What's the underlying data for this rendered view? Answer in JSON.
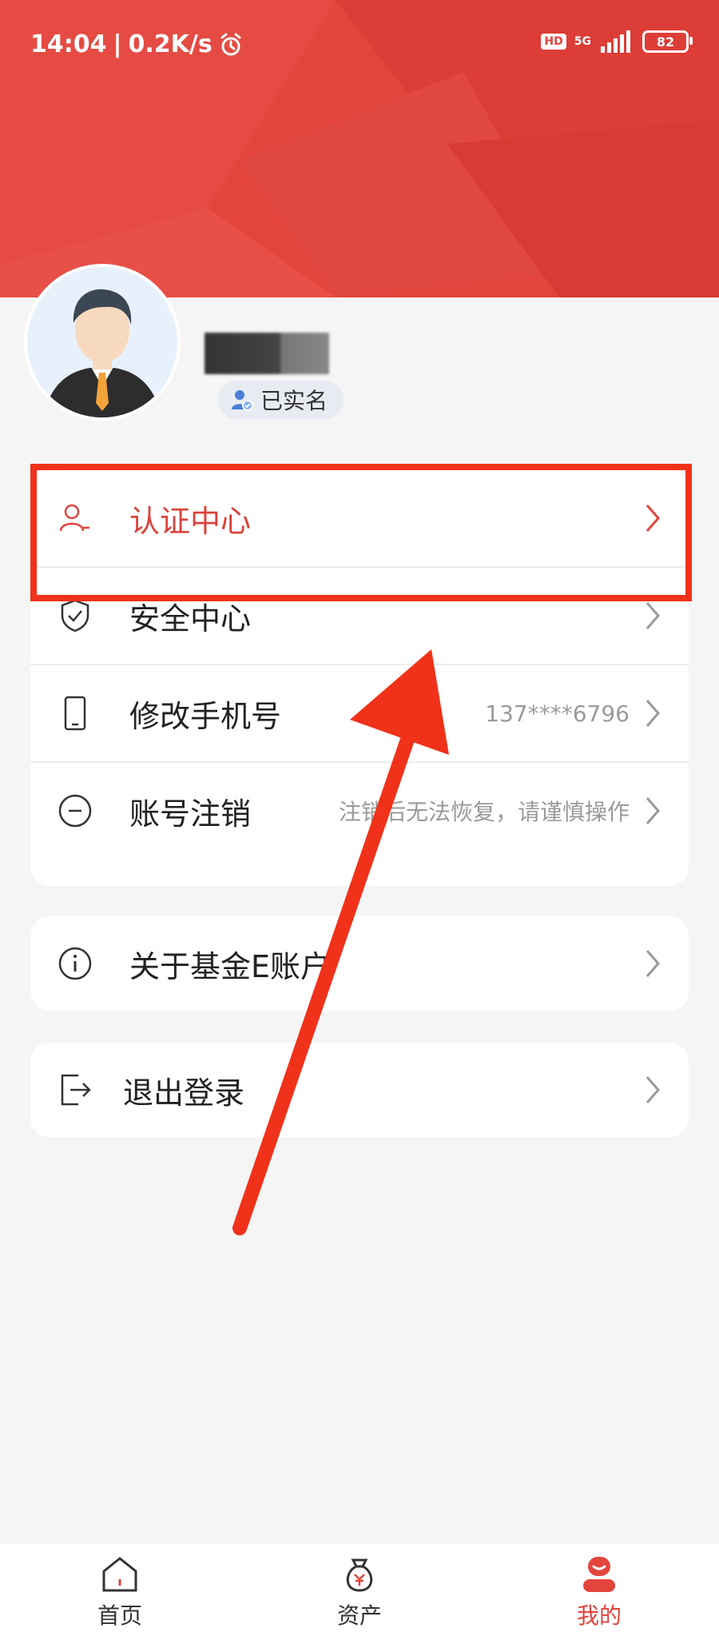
{
  "status_bar": {
    "time": "14:04",
    "network_speed": "0.2K/s",
    "separator": "|",
    "hd_label": "HD",
    "signal_label": "5G",
    "battery": "82"
  },
  "profile": {
    "verified_label": "已实名"
  },
  "menu_group_1": [
    {
      "label": "认证中心",
      "value": ""
    },
    {
      "label": "安全中心",
      "value": ""
    },
    {
      "label": "修改手机号",
      "value": "137****6796"
    },
    {
      "label": "账号注销",
      "value": "注销后无法恢复，请谨慎操作"
    }
  ],
  "about": {
    "label": "关于基金E账户"
  },
  "logout": {
    "label": "退出登录"
  },
  "bottom_nav": [
    {
      "label": "首页"
    },
    {
      "label": "资产"
    },
    {
      "label": "我的"
    }
  ],
  "colors": {
    "brand": "#e3443c",
    "highlight_outline": "#f0321a"
  }
}
